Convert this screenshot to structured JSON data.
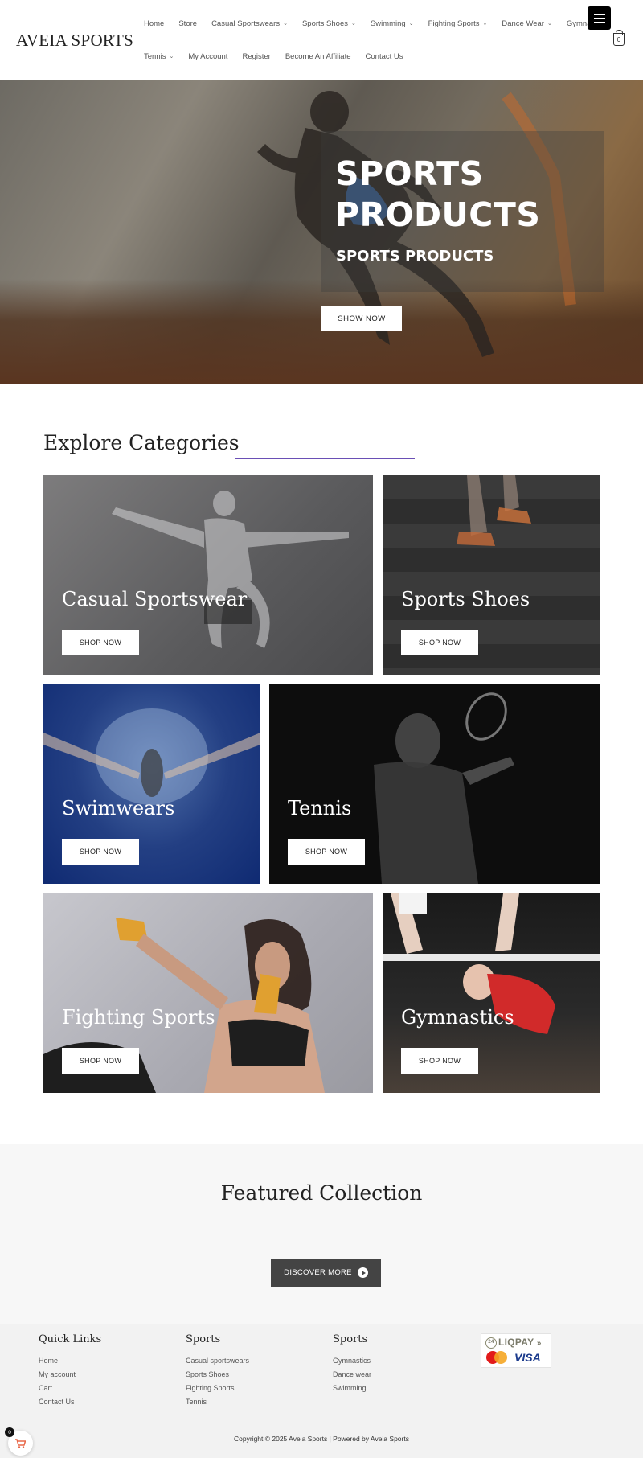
{
  "header": {
    "logo": "AVEIA SPORTS",
    "nav_row1": [
      {
        "label": "Home",
        "dropdown": false
      },
      {
        "label": "Store",
        "dropdown": false
      },
      {
        "label": "Casual Sportswears",
        "dropdown": true
      },
      {
        "label": "Sports Shoes",
        "dropdown": true
      },
      {
        "label": "Swimming",
        "dropdown": true
      },
      {
        "label": "Fighting Sports",
        "dropdown": true
      },
      {
        "label": "Dance Wear",
        "dropdown": true
      },
      {
        "label": "Gymnastics",
        "dropdown": false
      }
    ],
    "nav_row2": [
      {
        "label": "Tennis",
        "dropdown": true
      },
      {
        "label": "My Account",
        "dropdown": false
      },
      {
        "label": "Register",
        "dropdown": false
      },
      {
        "label": "Become An Affiliate",
        "dropdown": false
      },
      {
        "label": "Contact Us",
        "dropdown": false
      }
    ],
    "cart_count": "0"
  },
  "hero": {
    "title_line1": "SPORTS",
    "title_line2": "PRODUCTS",
    "subtitle": "SPORTS PRODUCTS",
    "button": "SHOW NOW"
  },
  "categories": {
    "title": "Explore Categories",
    "accent_color": "#6a4fb5",
    "items": [
      {
        "label": "Casual Sportswear",
        "button": "SHOP NOW"
      },
      {
        "label": "Sports Shoes",
        "button": "SHOP NOW"
      },
      {
        "label": "Swimwears",
        "button": "SHOP NOW"
      },
      {
        "label": "Tennis",
        "button": "SHOP NOW"
      },
      {
        "label": "Fighting Sports",
        "button": "SHOP NOW"
      },
      {
        "label": "Gymnastics",
        "button": "SHOP NOW"
      }
    ]
  },
  "featured": {
    "title": "Featured Collection",
    "button": "DISCOVER MORE"
  },
  "footer": {
    "columns": [
      {
        "heading": "Quick Links",
        "links": [
          "Home",
          "My account",
          "Cart",
          "Contact Us"
        ]
      },
      {
        "heading": "Sports",
        "links": [
          "Casual sportswears",
          "Sports Shoes",
          "Fighting Sports",
          "Tennis"
        ]
      },
      {
        "heading": "Sports",
        "links": [
          "Gymnastics",
          "Dance wear",
          "Swimming"
        ]
      }
    ],
    "payment": {
      "liqpay": "LIQPAY",
      "liqpay_badge": "24",
      "visa": "VISA",
      "mastercard": "mastercard"
    },
    "copyright": "Copyright © 2025 Aveia Sports | Powered by Aveia Sports"
  },
  "floating_cart": {
    "count": "0"
  }
}
